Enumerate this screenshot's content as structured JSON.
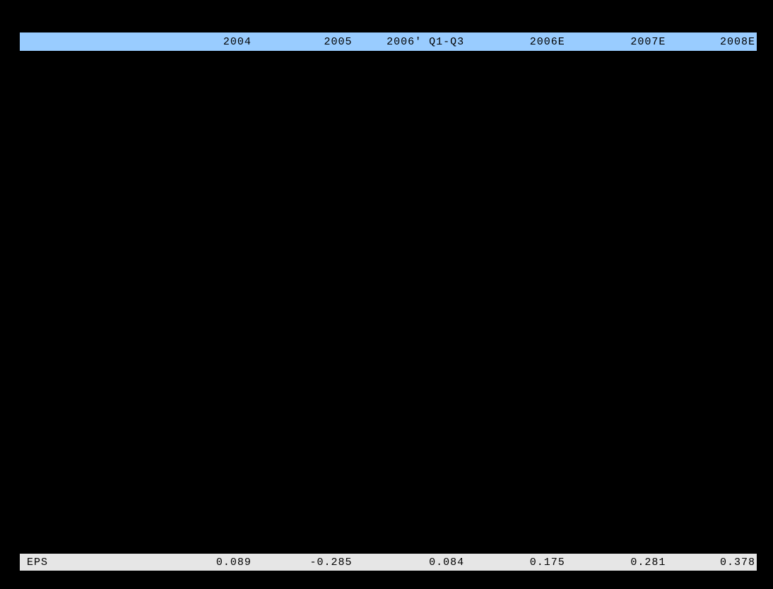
{
  "chart_data": {
    "type": "table",
    "columns": [
      "",
      "2004",
      "2005",
      "2006' Q1-Q3",
      "2006E",
      "2007E",
      "2008E"
    ],
    "rows": [
      {
        "label": "EPS",
        "values": [
          "0.089",
          "-0.285",
          "0.084",
          "0.175",
          "0.281",
          "0.378"
        ]
      }
    ]
  },
  "header": {
    "c0": "",
    "c1": "2004",
    "c2": "2005",
    "c3": "2006' Q1-Q3",
    "c4": "2006E",
    "c5": "2007E",
    "c6": "2008E"
  },
  "footer": {
    "c0": "EPS",
    "c1": "0.089",
    "c2": "-0.285",
    "c3": "0.084",
    "c4": "0.175",
    "c5": "0.281",
    "c6": "0.378"
  }
}
